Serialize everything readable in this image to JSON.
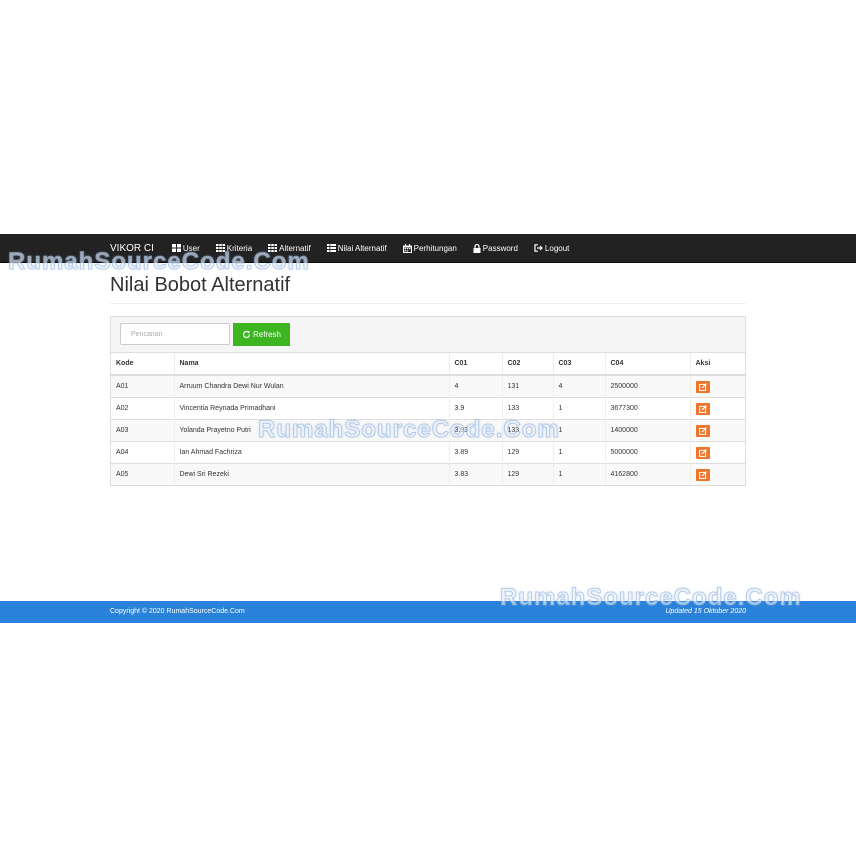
{
  "navbar": {
    "brand": "VIKOR CI",
    "items": [
      {
        "label": "User",
        "icon": "th-large-icon"
      },
      {
        "label": "Kriteria",
        "icon": "th-icon"
      },
      {
        "label": "Alternatif",
        "icon": "th-icon"
      },
      {
        "label": "Nilai Alternatif",
        "icon": "th-list-icon"
      },
      {
        "label": "Perhitungan",
        "icon": "calendar-icon"
      },
      {
        "label": "Password",
        "icon": "lock-icon"
      },
      {
        "label": "Logout",
        "icon": "log-out-icon"
      }
    ]
  },
  "watermark": "RumahSourceCode.Com",
  "page": {
    "title": "Nilai Bobot Alternatif"
  },
  "toolbar": {
    "search_placeholder": "Pencarian",
    "refresh_label": "Refresh"
  },
  "table": {
    "headers": [
      "Kode",
      "Nama",
      "C01",
      "C02",
      "C03",
      "C04",
      "Aksi"
    ],
    "rows": [
      {
        "kode": "A01",
        "nama": "Arruum Chandra Dewi Nur Wulan",
        "c01": "4",
        "c02": "131",
        "c03": "4",
        "c04": "2500000"
      },
      {
        "kode": "A02",
        "nama": "Vincentia Reynada Primadhani",
        "c01": "3.9",
        "c02": "133",
        "c03": "1",
        "c04": "3677300"
      },
      {
        "kode": "A03",
        "nama": "Yolanda Prayetno Putri",
        "c01": "3.93",
        "c02": "133",
        "c03": "1",
        "c04": "1400000"
      },
      {
        "kode": "A04",
        "nama": "Ian Ahmad Fachriza",
        "c01": "3.89",
        "c02": "129",
        "c03": "1",
        "c04": "5000000"
      },
      {
        "kode": "A05",
        "nama": "Dewi Sri Rezeki",
        "c01": "3.83",
        "c02": "129",
        "c03": "1",
        "c04": "4162800"
      }
    ]
  },
  "footer": {
    "copyright": "Copyright © 2020 RumahSourceCode.Com",
    "updated": "Updated 15 Oktober 2020"
  },
  "colors": {
    "navbar": "#222222",
    "refresh_button": "#3cb521",
    "edit_button": "#f0742a",
    "footer": "#2a82db"
  }
}
